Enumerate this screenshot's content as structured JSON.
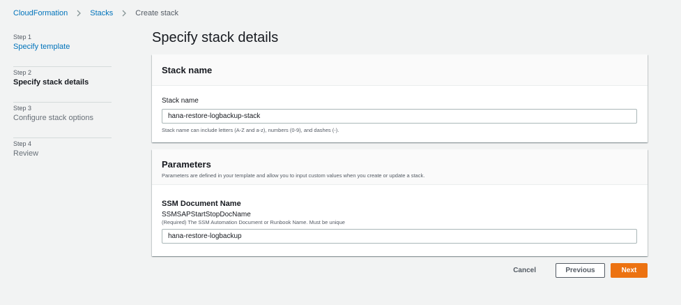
{
  "breadcrumb": {
    "items": [
      "CloudFormation",
      "Stacks",
      "Create stack"
    ]
  },
  "steps": [
    {
      "number": "Step 1",
      "label": "Specify template"
    },
    {
      "number": "Step 2",
      "label": "Specify stack details"
    },
    {
      "number": "Step 3",
      "label": "Configure stack options"
    },
    {
      "number": "Step 4",
      "label": "Review"
    }
  ],
  "main": {
    "title": "Specify stack details",
    "stack_name_panel": {
      "title": "Stack name",
      "field_label": "Stack name",
      "value": "hana-restore-logbackup-stack",
      "hint": "Stack name can include letters (A-Z and a-z), numbers (0-9), and dashes (-)."
    },
    "parameters_panel": {
      "title": "Parameters",
      "description": "Parameters are defined in your template and allow you to input custom values when you create or update a stack.",
      "group_label": "SSM Document Name",
      "param_key": "SSMSAPStartStopDocName",
      "param_desc": "(Required) The SSM Automation Document or Runbook Name. Must be unique",
      "value": "hana-restore-logbackup"
    }
  },
  "actions": {
    "cancel": "Cancel",
    "previous": "Previous",
    "next": "Next"
  },
  "colors": {
    "link": "#0073bb",
    "primary_button": "#ec7211",
    "background": "#f2f3f3"
  }
}
